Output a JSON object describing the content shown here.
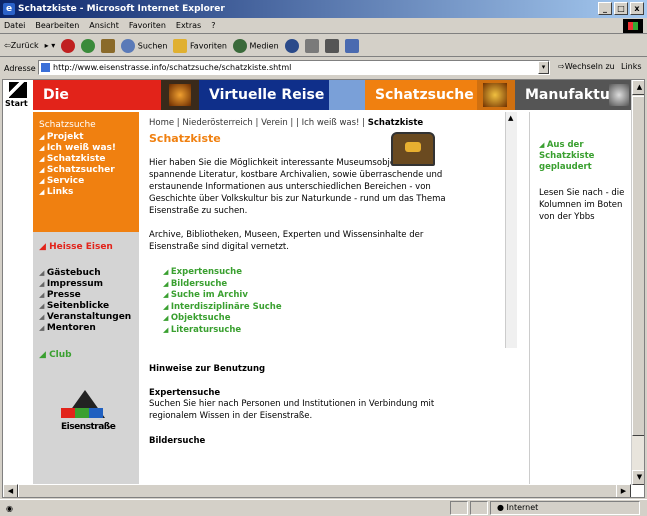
{
  "window": {
    "title": "Schatzkiste - Microsoft Internet Explorer",
    "buttons": [
      "_",
      "□",
      "x"
    ]
  },
  "menu": [
    "Datei",
    "Bearbeiten",
    "Ansicht",
    "Favoriten",
    "Extras",
    "?"
  ],
  "toolbar": {
    "back": "⇦Zurück",
    "search": "Suchen",
    "favorites": "Favoriten",
    "media": "Medien"
  },
  "address": {
    "label": "Adresse",
    "url": "http://www.eisenstrasse.info/schatzsuche/schatzkiste.shtml",
    "go": "Wechseln zu",
    "links": "Links"
  },
  "topnav": {
    "start": "Start",
    "items": [
      "Die Eisenstraße",
      "Virtuelle Reise",
      "Schatzsuche",
      "Manufaktur"
    ]
  },
  "sidebar": {
    "section_title": "Schatzsuche",
    "items": [
      "Projekt",
      "Ich weiß was!",
      "Schatzkiste",
      "Schatzsucher",
      "Service",
      "Links"
    ],
    "heisse": "Heisse Eisen",
    "secondary": [
      "Gästebuch",
      "Impressum",
      "Presse",
      "Seitenblicke",
      "Veranstaltungen",
      "Mentoren"
    ],
    "club": "Club",
    "logo_text": "Eisenstraße"
  },
  "main": {
    "breadcrumb": [
      "Home",
      "Niederösterreich",
      "Verein",
      "",
      "Ich weiß was!",
      "Schatzkiste"
    ],
    "title": "Schatzkiste",
    "intro": "Hier haben Sie die Möglichkeit interessante Museumsobjekte, spannende Literatur, kostbare Archivalien, sowie überraschende und erstaunende Informationen aus unterschiedlichen Bereichen - von Geschichte über Volkskultur bis zur Naturkunde - rund um das Thema Eisenstraße zu suchen.",
    "intro2": "Archive, Bibliotheken, Museen, Experten und Wissensinhalte der Eisenstraße sind digital vernetzt.",
    "search_links": [
      "Expertensuche",
      "Bildersuche",
      "Suche im Archiv",
      "Interdisziplinäre Suche",
      "Objektsuche",
      "Literatursuche"
    ],
    "hints_title": "Hinweise zur Benutzung",
    "expert_title": "Expertensuche",
    "expert_text": "Suchen Sie hier nach Personen und Institutionen in Verbindung mit regionalem Wissen in der Eisenstraße.",
    "bild_title": "Bildersuche"
  },
  "right": {
    "link": "Aus der Schatzkiste geplaudert",
    "text": "Lesen Sie nach - die Kolumnen im Boten von der Ybbs"
  },
  "status": {
    "zone": "Internet"
  }
}
